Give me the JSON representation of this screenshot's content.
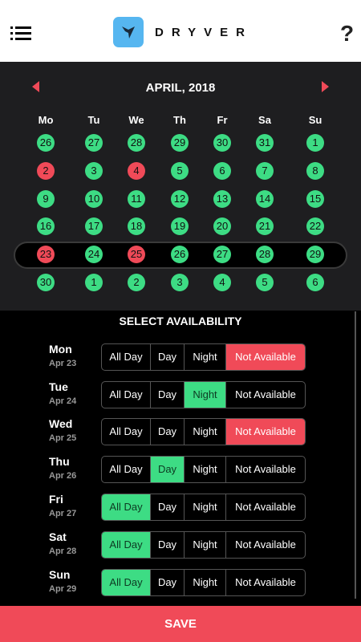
{
  "header": {
    "brand": "DRYVER",
    "help": "?"
  },
  "calendar": {
    "month": "APRIL, 2018",
    "weekdays": [
      "Mo",
      "Tu",
      "We",
      "Th",
      "Fr",
      "Sa",
      "Su"
    ],
    "weeks": [
      [
        {
          "d": "26",
          "s": "green"
        },
        {
          "d": "27",
          "s": "green"
        },
        {
          "d": "28",
          "s": "green"
        },
        {
          "d": "29",
          "s": "green"
        },
        {
          "d": "30",
          "s": "green"
        },
        {
          "d": "31",
          "s": "green"
        },
        {
          "d": "1",
          "s": "green"
        }
      ],
      [
        {
          "d": "2",
          "s": "red"
        },
        {
          "d": "3",
          "s": "green"
        },
        {
          "d": "4",
          "s": "red"
        },
        {
          "d": "5",
          "s": "green"
        },
        {
          "d": "6",
          "s": "green"
        },
        {
          "d": "7",
          "s": "green"
        },
        {
          "d": "8",
          "s": "green"
        }
      ],
      [
        {
          "d": "9",
          "s": "green"
        },
        {
          "d": "10",
          "s": "green"
        },
        {
          "d": "11",
          "s": "green"
        },
        {
          "d": "12",
          "s": "green"
        },
        {
          "d": "13",
          "s": "green"
        },
        {
          "d": "14",
          "s": "green"
        },
        {
          "d": "15",
          "s": "green"
        }
      ],
      [
        {
          "d": "16",
          "s": "green"
        },
        {
          "d": "17",
          "s": "green"
        },
        {
          "d": "18",
          "s": "green"
        },
        {
          "d": "19",
          "s": "green"
        },
        {
          "d": "20",
          "s": "green"
        },
        {
          "d": "21",
          "s": "green"
        },
        {
          "d": "22",
          "s": "green"
        }
      ],
      [
        {
          "d": "23",
          "s": "red"
        },
        {
          "d": "24",
          "s": "green"
        },
        {
          "d": "25",
          "s": "red"
        },
        {
          "d": "26",
          "s": "green"
        },
        {
          "d": "27",
          "s": "green"
        },
        {
          "d": "28",
          "s": "green"
        },
        {
          "d": "29",
          "s": "green"
        }
      ],
      [
        {
          "d": "30",
          "s": "green"
        },
        {
          "d": "1",
          "s": "green"
        },
        {
          "d": "2",
          "s": "green"
        },
        {
          "d": "3",
          "s": "green"
        },
        {
          "d": "4",
          "s": "green"
        },
        {
          "d": "5",
          "s": "green"
        },
        {
          "d": "6",
          "s": "green"
        }
      ]
    ],
    "selected_week": 4
  },
  "availability": {
    "title": "SELECT AVAILABILITY",
    "options": [
      "All Day",
      "Day",
      "Night",
      "Not Available"
    ],
    "rows": [
      {
        "day": "Mon",
        "date": "Apr 23",
        "selected": 3
      },
      {
        "day": "Tue",
        "date": "Apr 24",
        "selected": 2
      },
      {
        "day": "Wed",
        "date": "Apr 25",
        "selected": 3
      },
      {
        "day": "Thu",
        "date": "Apr 26",
        "selected": 1
      },
      {
        "day": "Fri",
        "date": "Apr 27",
        "selected": 0
      },
      {
        "day": "Sat",
        "date": "Apr 28",
        "selected": 0
      },
      {
        "day": "Sun",
        "date": "Apr 29",
        "selected": 0
      }
    ]
  },
  "colors": {
    "available": "#3ddc84",
    "unavailable": "#f04a58",
    "brand": "#56b6f0"
  },
  "save_label": "SAVE"
}
